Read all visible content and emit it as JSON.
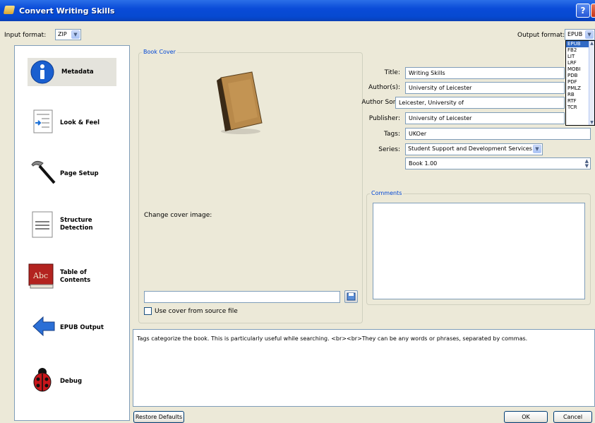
{
  "window": {
    "title": "Convert Writing Skills",
    "help": "?",
    "close": "X"
  },
  "format": {
    "input_label": "Input format:",
    "input_value": "ZIP",
    "output_label": "Output format:",
    "output_value": "EPUB",
    "output_options": [
      "EPUB",
      "FB2",
      "LIT",
      "LRF",
      "MOBI",
      "PDB",
      "PDF",
      "PMLZ",
      "RB",
      "RTF",
      "TCR"
    ]
  },
  "sidebar": {
    "items": [
      {
        "label": "Metadata",
        "icon": "info-icon"
      },
      {
        "label": "Look & Feel",
        "icon": "indent-icon"
      },
      {
        "label": "Page Setup",
        "icon": "hammer-icon"
      },
      {
        "label": "Structure",
        "label2": "Detection",
        "icon": "document-icon"
      },
      {
        "label": "Table of",
        "label2": "Contents",
        "icon": "book-abc-icon"
      },
      {
        "label": "EPUB Output",
        "icon": "arrow-left-icon"
      },
      {
        "label": "Debug",
        "icon": "ladybug-icon"
      }
    ]
  },
  "cover": {
    "group_title": "Book Cover",
    "change_label": "Change cover image:",
    "path_value": "",
    "use_source_label": "Use cover from source file",
    "use_source_checked": false
  },
  "metadata": {
    "title_label": "Title:",
    "title_value": "Writing Skills",
    "author_label": "Author(s):",
    "author_value": "University of Leicester",
    "author_sort_label": "Author Sort:",
    "author_sort_value": "Leicester, University of",
    "publisher_label": "Publisher:",
    "publisher_value": "University of Leicester",
    "tags_label": "Tags:",
    "tags_value": "UKOer",
    "series_label": "Series:",
    "series_value": "Student Support and Development Services",
    "series_index": "Book 1.00"
  },
  "comments": {
    "group_title": "Comments",
    "value": ""
  },
  "help_text": "Tags categorize the book. This is particularly useful while searching. <br><br>They can be any words or phrases, separated by commas.",
  "buttons": {
    "restore": "Restore Defaults",
    "ok": "OK",
    "cancel": "Cancel"
  },
  "colors": {
    "titlebar": "#0a4bd8",
    "accent": "#0046d5",
    "selection": "#316ac5"
  }
}
